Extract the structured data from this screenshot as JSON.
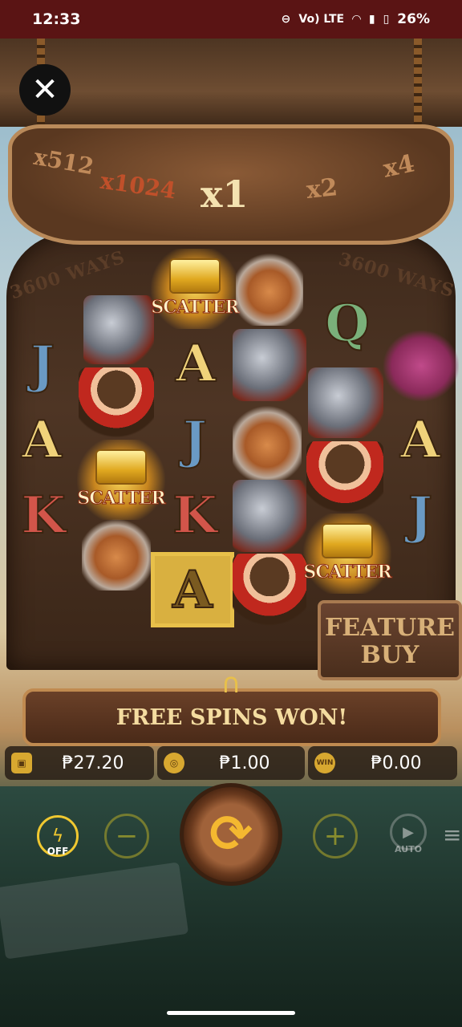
{
  "status_bar": {
    "time": "12:33",
    "network": "Vo) LTE",
    "battery": "26%"
  },
  "multipliers": {
    "m1": "x512",
    "m2": "x1024",
    "current": "x1",
    "m4": "x2",
    "m5": "x4"
  },
  "ways": {
    "left": "3600 WAYS",
    "right": "3600 WAYS"
  },
  "reels": {
    "scatter_label": "SCATTER",
    "letters": {
      "j": "J",
      "a": "A",
      "k": "K",
      "q": "Q"
    }
  },
  "feature_buy": {
    "line1": "FEATURE",
    "line2": "BUY"
  },
  "banner": {
    "text": "FREE SPINS WON!"
  },
  "info": {
    "balance": "₱27.20",
    "bet": "₱1.00",
    "win": "₱0.00",
    "win_icon_label": "WIN"
  },
  "controls": {
    "turbo_label": "OFF",
    "auto_label": "AUTO"
  },
  "colors": {
    "status_bar": "#5a1414",
    "gold": "#f0c830",
    "banner_text": "#f4dca0"
  }
}
